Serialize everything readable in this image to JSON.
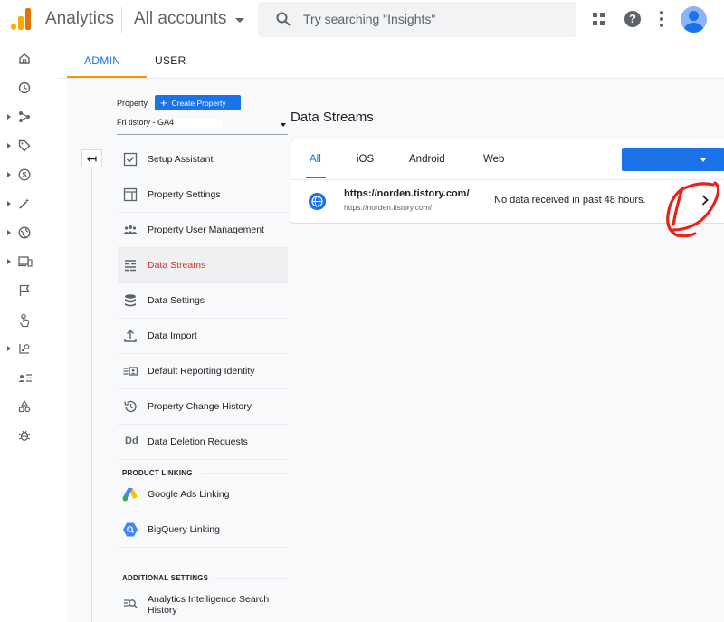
{
  "app": {
    "title": "Analytics",
    "account_selector": "All accounts"
  },
  "search": {
    "placeholder": "Try searching \"Insights\""
  },
  "admin_tabs": {
    "admin": "ADMIN",
    "user": "USER"
  },
  "property": {
    "label": "Property",
    "create_button": "Create Property",
    "selected": "Fri tistory - GA4 ("
  },
  "menu": {
    "items": [
      {
        "label": "Setup Assistant",
        "icon": "checkbox-icon"
      },
      {
        "label": "Property Settings",
        "icon": "property-settings-icon"
      },
      {
        "label": "Property User Management",
        "icon": "users-icon"
      },
      {
        "label": "Data Streams",
        "icon": "data-streams-icon",
        "active": true
      },
      {
        "label": "Data Settings",
        "icon": "database-icon"
      },
      {
        "label": "Data Import",
        "icon": "upload-icon"
      },
      {
        "label": "Default Reporting Identity",
        "icon": "reporting-identity-icon"
      },
      {
        "label": "Property Change History",
        "icon": "history-icon"
      },
      {
        "label": "Data Deletion Requests",
        "icon": "dd-icon",
        "badge": "Dd"
      }
    ],
    "product_linking": {
      "heading": "PRODUCT LINKING",
      "items": [
        {
          "label": "Google Ads Linking",
          "icon": "google-ads-icon"
        },
        {
          "label": "BigQuery Linking",
          "icon": "bigquery-icon"
        }
      ]
    },
    "additional_settings": {
      "heading": "ADDITIONAL SETTINGS",
      "items": [
        {
          "label_line1": "Analytics Intelligence Search",
          "label_line2": "History",
          "icon": "search-history-icon"
        }
      ]
    }
  },
  "data_streams": {
    "title": "Data Streams",
    "tabs": [
      "All",
      "iOS",
      "Android",
      "Web"
    ],
    "active_tab": "All",
    "add_stream": "Add stream",
    "streams": [
      {
        "name": "https://norden.tistory.com/",
        "url": "https://norden.tistory.com/",
        "status": "No data received in past 48 hours."
      }
    ]
  },
  "colors": {
    "accent": "#1a73e8",
    "active_menu_text": "#d93025",
    "tab_underline": "#f29900",
    "annotation": "#e8221b"
  }
}
